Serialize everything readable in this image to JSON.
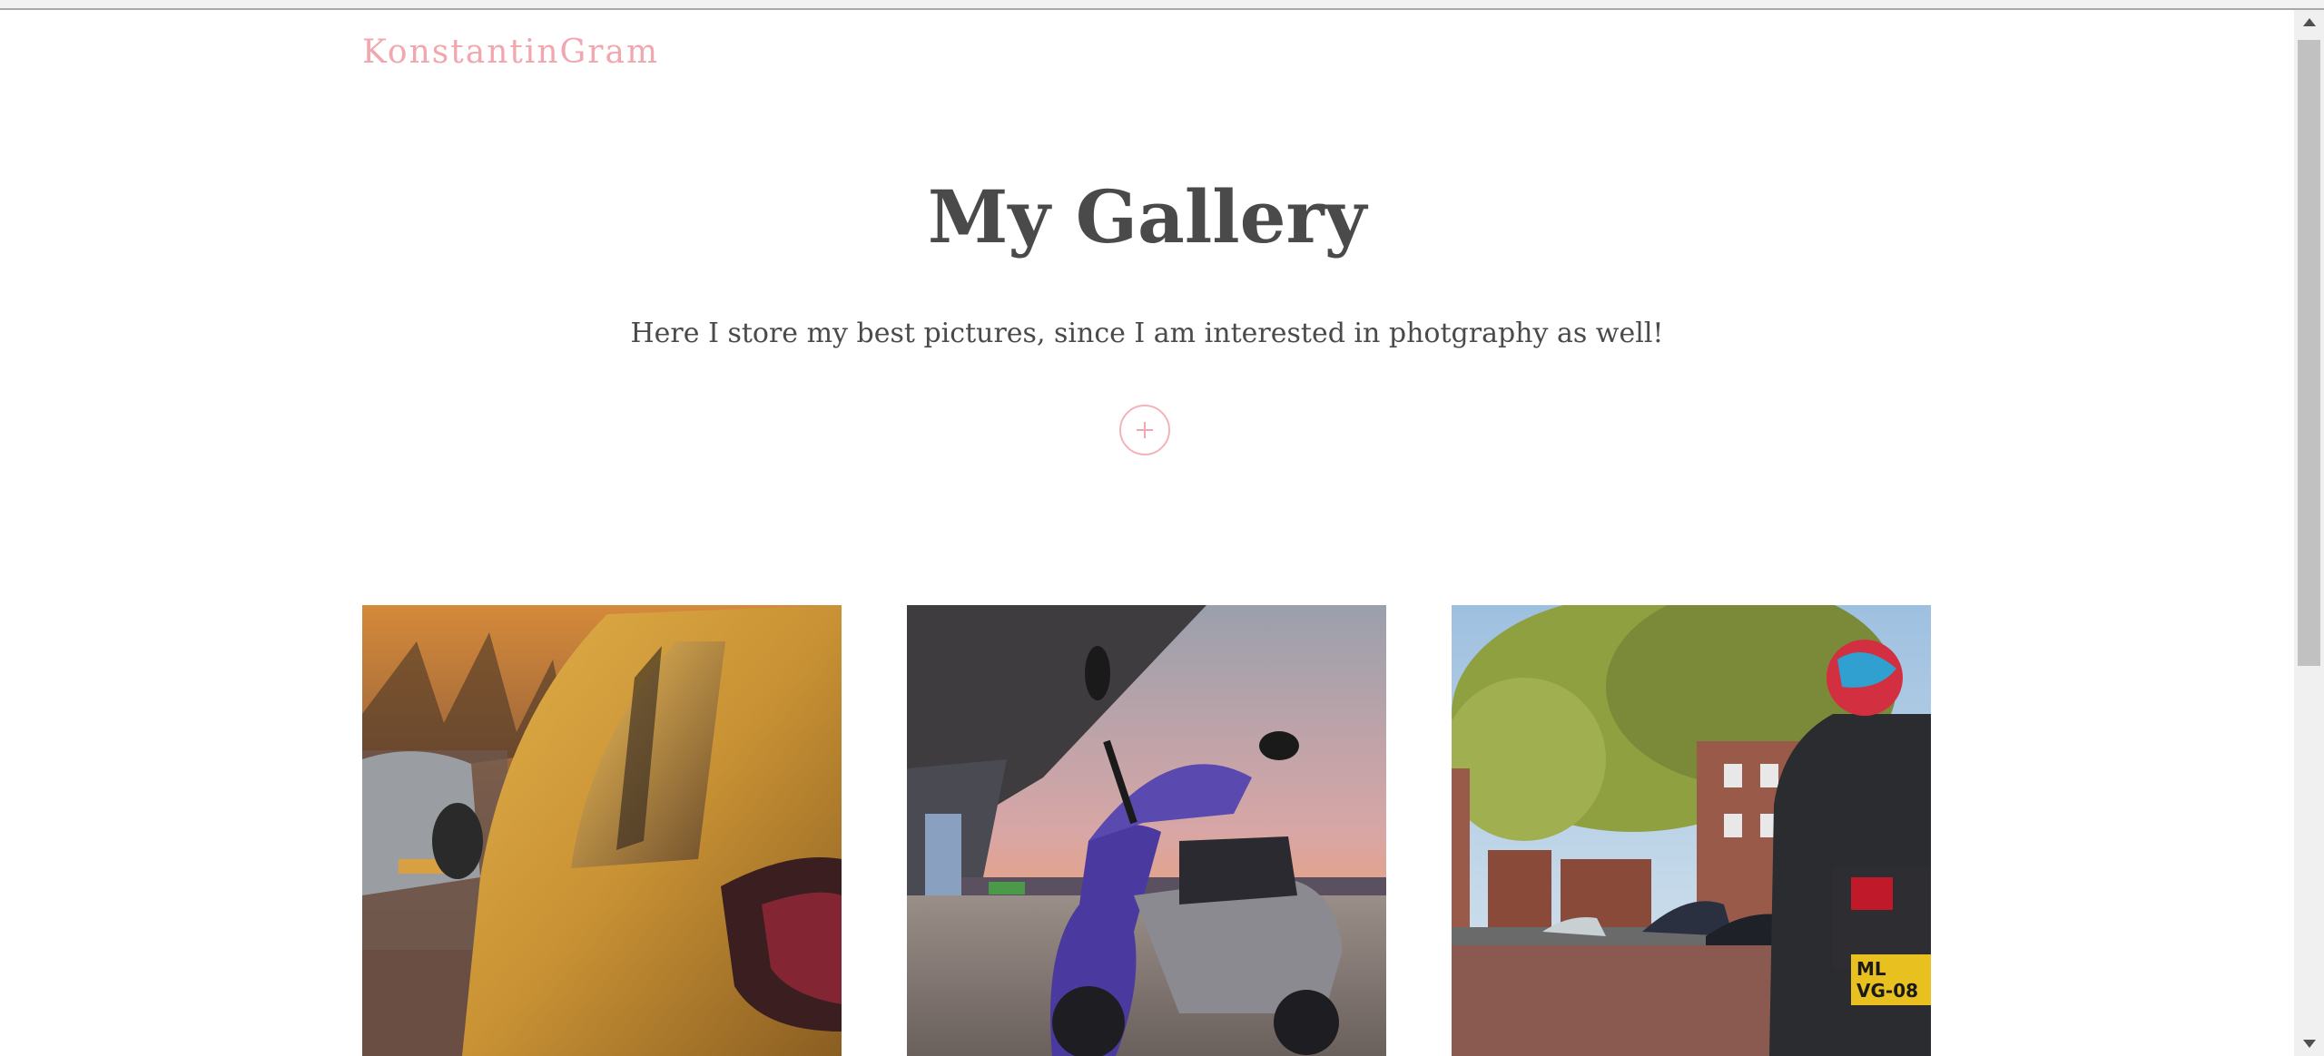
{
  "header": {
    "brand": "KonstantinGram"
  },
  "main": {
    "title": "My Gallery",
    "subtitle": "Here I store my best pictures, since I am interested in photgraphy as well!",
    "add_button_icon": "plus-icon"
  },
  "gallery": {
    "photos": [
      {
        "subject": "yellow car at sunset"
      },
      {
        "subject": "purple scooter at sunset"
      },
      {
        "subject": "motorcyclist on street"
      }
    ]
  },
  "colors": {
    "brand": "#f0a7ad",
    "heading": "#4a4a4a",
    "accent_border": "#f4b3b8"
  }
}
